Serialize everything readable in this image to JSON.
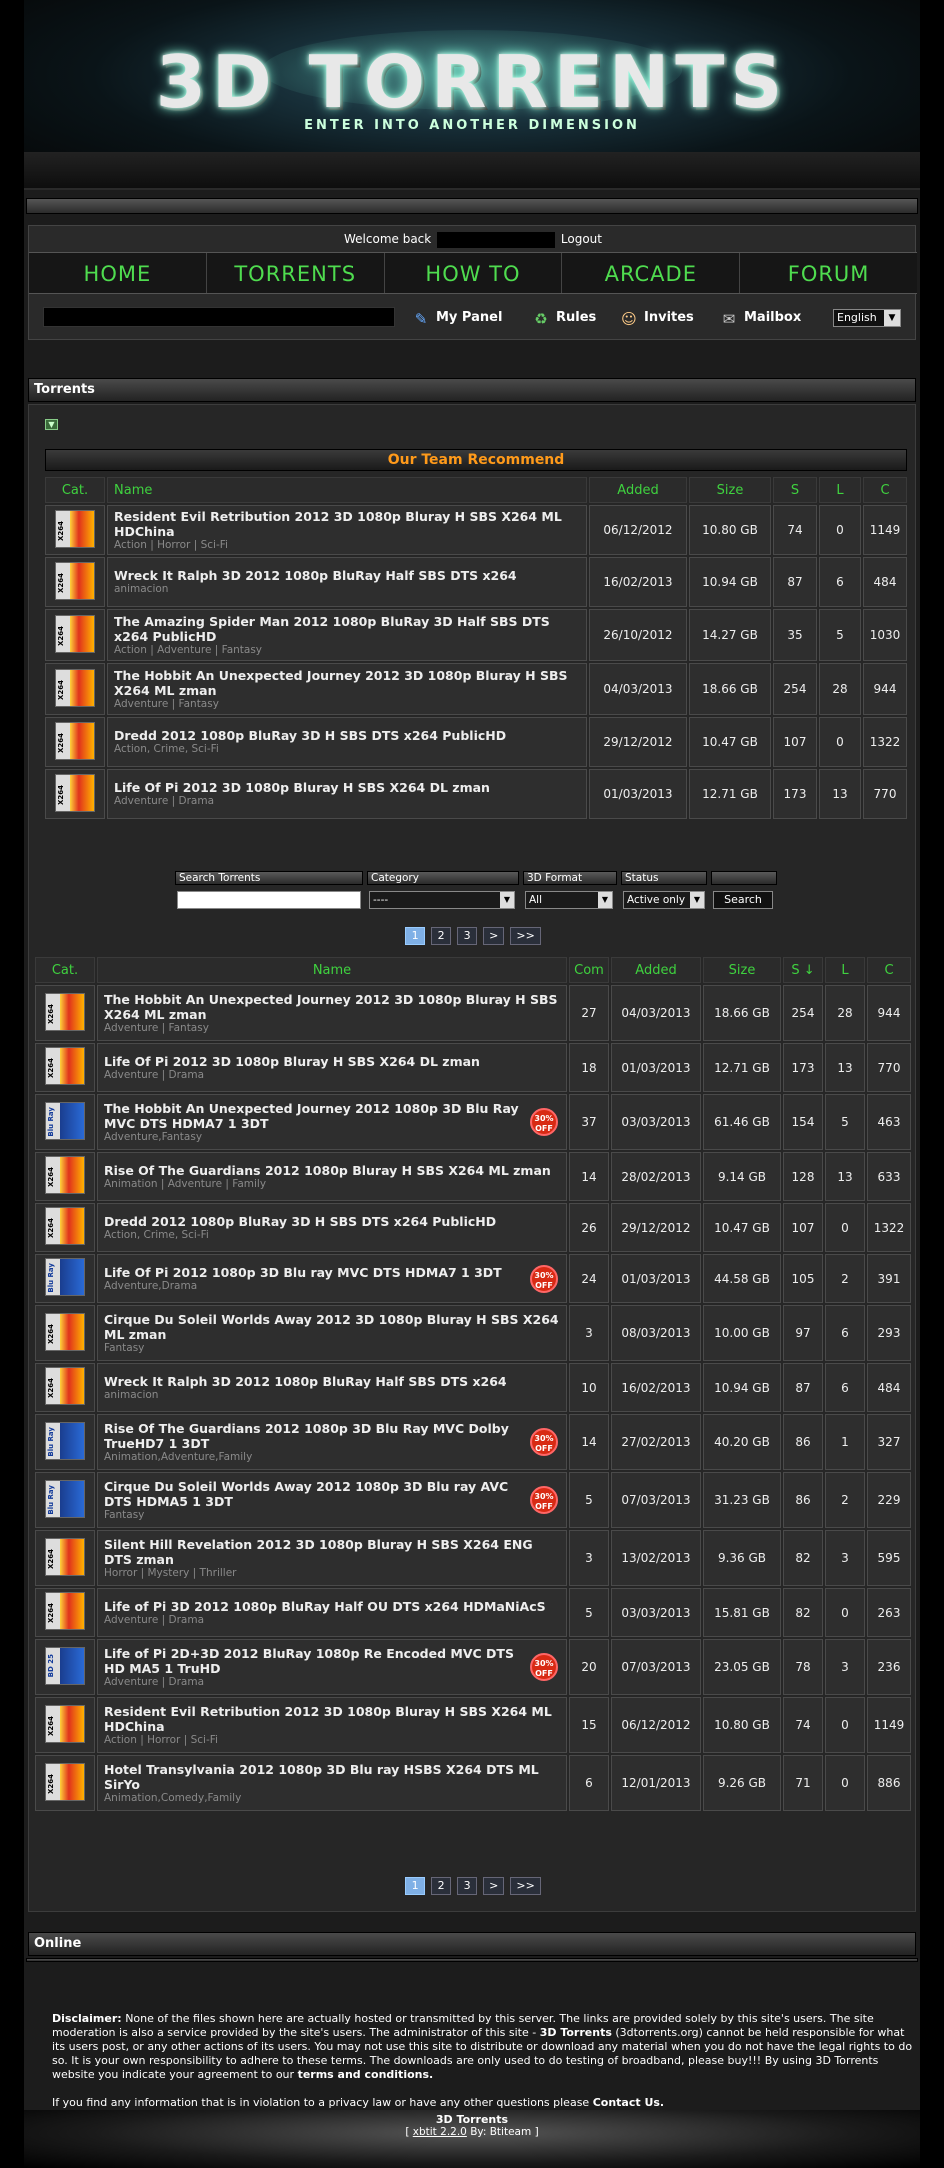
{
  "header": {
    "logo": "3D TORRENTS",
    "tagline": "ENTER INTO ANOTHER DIMENSION"
  },
  "welcome": {
    "prefix": "Welcome back",
    "logout": "Logout"
  },
  "menu": [
    "HOME",
    "TORRENTS",
    "HOW TO",
    "ARCADE",
    "FORUM"
  ],
  "tools": [
    {
      "icon": "my-panel-icon",
      "label": "My Panel"
    },
    {
      "icon": "rules-icon",
      "label": "Rules"
    },
    {
      "icon": "invites-icon",
      "label": "Invites"
    },
    {
      "icon": "mailbox-icon",
      "label": "Mailbox"
    }
  ],
  "language": "English",
  "sections": {
    "torrents": "Torrents",
    "online": "Online",
    "recommend": "Our Team Recommend"
  },
  "rec_headers": [
    "Cat.",
    "Name",
    "Added",
    "Size",
    "S",
    "L",
    "C"
  ],
  "recommended": [
    {
      "cat": "x264",
      "name": "Resident Evil Retribution 2012 3D 1080p Bluray H SBS X264 ML HDChina",
      "genre": "Action | Horror | Sci-Fi",
      "added": "06/12/2012",
      "size": "10.80 GB",
      "s": "74",
      "l": "0",
      "c": "1149"
    },
    {
      "cat": "x264",
      "name": "Wreck It Ralph 3D 2012 1080p BluRay Half SBS DTS x264",
      "genre": "animacion",
      "added": "16/02/2013",
      "size": "10.94 GB",
      "s": "87",
      "l": "6",
      "c": "484"
    },
    {
      "cat": "x264",
      "name": "The Amazing Spider Man 2012 1080p BluRay 3D Half SBS DTS x264 PublicHD",
      "genre": "Action | Adventure | Fantasy",
      "added": "26/10/2012",
      "size": "14.27 GB",
      "s": "35",
      "l": "5",
      "c": "1030"
    },
    {
      "cat": "x264",
      "name": "The Hobbit An Unexpected Journey 2012 3D 1080p Bluray H SBS X264 ML zman",
      "genre": "Adventure | Fantasy",
      "added": "04/03/2013",
      "size": "18.66 GB",
      "s": "254",
      "l": "28",
      "c": "944"
    },
    {
      "cat": "x264",
      "name": "Dredd 2012 1080p BluRay 3D H SBS DTS x264 PublicHD",
      "genre": "Action, Crime, Sci-Fi",
      "added": "29/12/2012",
      "size": "10.47 GB",
      "s": "107",
      "l": "0",
      "c": "1322"
    },
    {
      "cat": "x264",
      "name": "Life Of Pi 2012 3D 1080p Bluray H SBS X264 DL zman",
      "genre": "Adventure | Drama",
      "added": "01/03/2013",
      "size": "12.71 GB",
      "s": "173",
      "l": "13",
      "c": "770"
    }
  ],
  "search": {
    "labels": [
      "Search Torrents",
      "Category",
      "3D Format",
      "Status"
    ],
    "category": "----",
    "format": "All",
    "status": "Active only",
    "button": "Search"
  },
  "pager": [
    "1",
    "2",
    "3",
    ">",
    ">>"
  ],
  "list_headers": [
    "Cat.",
    "Name",
    "Com",
    "Added",
    "Size",
    "S ↓",
    "L",
    "C"
  ],
  "torrents": [
    {
      "cat": "x264",
      "name": "The Hobbit An Unexpected Journey 2012 3D 1080p Bluray H SBS X264 ML zman",
      "genre": "Adventure | Fantasy",
      "com": "27",
      "added": "04/03/2013",
      "size": "18.66 GB",
      "s": "254",
      "l": "28",
      "c": "944",
      "sale": false
    },
    {
      "cat": "x264",
      "name": "Life Of Pi 2012 3D 1080p Bluray H SBS X264 DL zman",
      "genre": "Adventure | Drama",
      "com": "18",
      "added": "01/03/2013",
      "size": "12.71 GB",
      "s": "173",
      "l": "13",
      "c": "770",
      "sale": false
    },
    {
      "cat": "bluray",
      "name": "The Hobbit An Unexpected Journey 2012 1080p 3D Blu Ray MVC DTS HDMA7 1 3DT",
      "genre": "Adventure,Fantasy",
      "com": "37",
      "added": "03/03/2013",
      "size": "61.46 GB",
      "s": "154",
      "l": "5",
      "c": "463",
      "sale": true
    },
    {
      "cat": "x264",
      "name": "Rise Of The Guardians 2012 1080p Bluray H SBS X264 ML zman",
      "genre": "Animation | Adventure | Family",
      "com": "14",
      "added": "28/02/2013",
      "size": "9.14 GB",
      "s": "128",
      "l": "13",
      "c": "633",
      "sale": false
    },
    {
      "cat": "x264",
      "name": "Dredd 2012 1080p BluRay 3D H SBS DTS x264 PublicHD",
      "genre": "Action, Crime, Sci-Fi",
      "com": "26",
      "added": "29/12/2012",
      "size": "10.47 GB",
      "s": "107",
      "l": "0",
      "c": "1322",
      "sale": false
    },
    {
      "cat": "bluray",
      "name": "Life Of Pi 2012 1080p 3D Blu ray MVC DTS HDMA7 1 3DT",
      "genre": "Adventure,Drama",
      "com": "24",
      "added": "01/03/2013",
      "size": "44.58 GB",
      "s": "105",
      "l": "2",
      "c": "391",
      "sale": true
    },
    {
      "cat": "x264",
      "name": "Cirque Du Soleil Worlds Away 2012 3D 1080p Bluray H SBS X264 ML zman",
      "genre": "Fantasy",
      "com": "3",
      "added": "08/03/2013",
      "size": "10.00 GB",
      "s": "97",
      "l": "6",
      "c": "293",
      "sale": false
    },
    {
      "cat": "x264",
      "name": "Wreck It Ralph 3D 2012 1080p BluRay Half SBS DTS x264",
      "genre": "animacion",
      "com": "10",
      "added": "16/02/2013",
      "size": "10.94 GB",
      "s": "87",
      "l": "6",
      "c": "484",
      "sale": false
    },
    {
      "cat": "bluray",
      "name": "Rise Of The Guardians 2012 1080p 3D Blu Ray MVC Dolby TrueHD7 1 3DT",
      "genre": "Animation,Adventure,Family",
      "com": "14",
      "added": "27/02/2013",
      "size": "40.20 GB",
      "s": "86",
      "l": "1",
      "c": "327",
      "sale": true
    },
    {
      "cat": "bluray",
      "name": "Cirque Du Soleil Worlds Away 2012 1080p 3D Blu ray AVC DTS HDMA5 1 3DT",
      "genre": "Fantasy",
      "com": "5",
      "added": "07/03/2013",
      "size": "31.23 GB",
      "s": "86",
      "l": "2",
      "c": "229",
      "sale": true
    },
    {
      "cat": "x264",
      "name": "Silent Hill Revelation 2012 3D 1080p Bluray H SBS X264 ENG DTS zman",
      "genre": "Horror | Mystery | Thriller",
      "com": "3",
      "added": "13/02/2013",
      "size": "9.36 GB",
      "s": "82",
      "l": "3",
      "c": "595",
      "sale": false
    },
    {
      "cat": "x264",
      "name": "Life of Pi 3D 2012 1080p BluRay Half OU DTS x264 HDMaNiAcS",
      "genre": "Adventure | Drama",
      "com": "5",
      "added": "03/03/2013",
      "size": "15.81 GB",
      "s": "82",
      "l": "0",
      "c": "263",
      "sale": false
    },
    {
      "cat": "bd25",
      "name": "Life of Pi 2D+3D 2012 BluRay 1080p Re Encoded MVC DTS HD MA5 1 TruHD",
      "genre": "Adventure | Drama",
      "com": "20",
      "added": "07/03/2013",
      "size": "23.05 GB",
      "s": "78",
      "l": "3",
      "c": "236",
      "sale": true
    },
    {
      "cat": "x264",
      "name": "Resident Evil Retribution 2012 3D 1080p Bluray H SBS X264 ML HDChina",
      "genre": "Action | Horror | Sci-Fi",
      "com": "15",
      "added": "06/12/2012",
      "size": "10.80 GB",
      "s": "74",
      "l": "0",
      "c": "1149",
      "sale": false
    },
    {
      "cat": "x264",
      "name": "Hotel Transylvania 2012 1080p 3D Blu ray HSBS X264 DTS ML SirYo",
      "genre": "Animation,Comedy,Family",
      "com": "6",
      "added": "12/01/2013",
      "size": "9.26 GB",
      "s": "71",
      "l": "0",
      "c": "886",
      "sale": false
    }
  ],
  "sale_badge": "30% OFF",
  "footer": {
    "disclaimer_label": "Disclaimer:",
    "disclaimer_a": "None of the files shown here are actually hosted or transmitted by this server. The links are provided solely by this site's users. The site moderation is also a service provided by the site's users. The administrator of this site -",
    "site_bold": "3D Torrents",
    "disclaimer_b": "(3dtorrents.org) cannot be held responsible for what its users post, or any other actions of its users. You may not use this site to distribute or download any material when you do not have the legal rights to do so. It is your own responsibility to adhere to these terms. The downloads are only used to do testing of broadband, please buy!!! By using 3D Torrents website you indicate your agreement to our",
    "terms": "terms and conditions.",
    "privacy": "If you find any information that is in violation to a privacy law or have any other questions please",
    "contact": "Contact Us.",
    "credit_title": "3D Torrents",
    "credit_open": "[",
    "credit_link": "xbtit 2.2.0",
    "credit_by": "By: Btiteam",
    "credit_close": "]"
  }
}
